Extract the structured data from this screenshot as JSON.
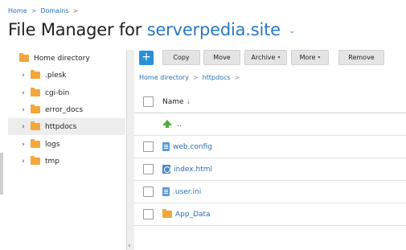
{
  "breadcrumb": {
    "items": [
      "Home",
      "Domains"
    ],
    "sep": ">"
  },
  "page": {
    "title_prefix": "File Manager for",
    "domain": "serverpedia.site",
    "caret": "⌄"
  },
  "sidebar": {
    "root": "Home directory",
    "items": [
      {
        "label": ".plesk"
      },
      {
        "label": "cgi-bin"
      },
      {
        "label": "error_docs"
      },
      {
        "label": "httpdocs"
      },
      {
        "label": "logs"
      },
      {
        "label": "tmp"
      }
    ]
  },
  "toolbar": {
    "add": "+",
    "copy": "Copy",
    "move": "Move",
    "archive": "Archive",
    "more": "More",
    "remove": "Remove",
    "dd": "▾"
  },
  "path": {
    "home": "Home directory",
    "current": "httpdocs",
    "sep": ">"
  },
  "table": {
    "header": "Name",
    "sort": "↓",
    "up": "..",
    "files": [
      {
        "name": "web.config",
        "type": "file"
      },
      {
        "name": "index.html",
        "type": "html"
      },
      {
        "name": ".user.ini",
        "type": "file"
      },
      {
        "name": "App_Data",
        "type": "folder"
      }
    ]
  },
  "chevrons": {
    "right": "›",
    "left": "‹"
  },
  "colors": {
    "accent": "#2a78c2",
    "folder": "#f3a73b",
    "add_button": "#2c8fd6"
  }
}
